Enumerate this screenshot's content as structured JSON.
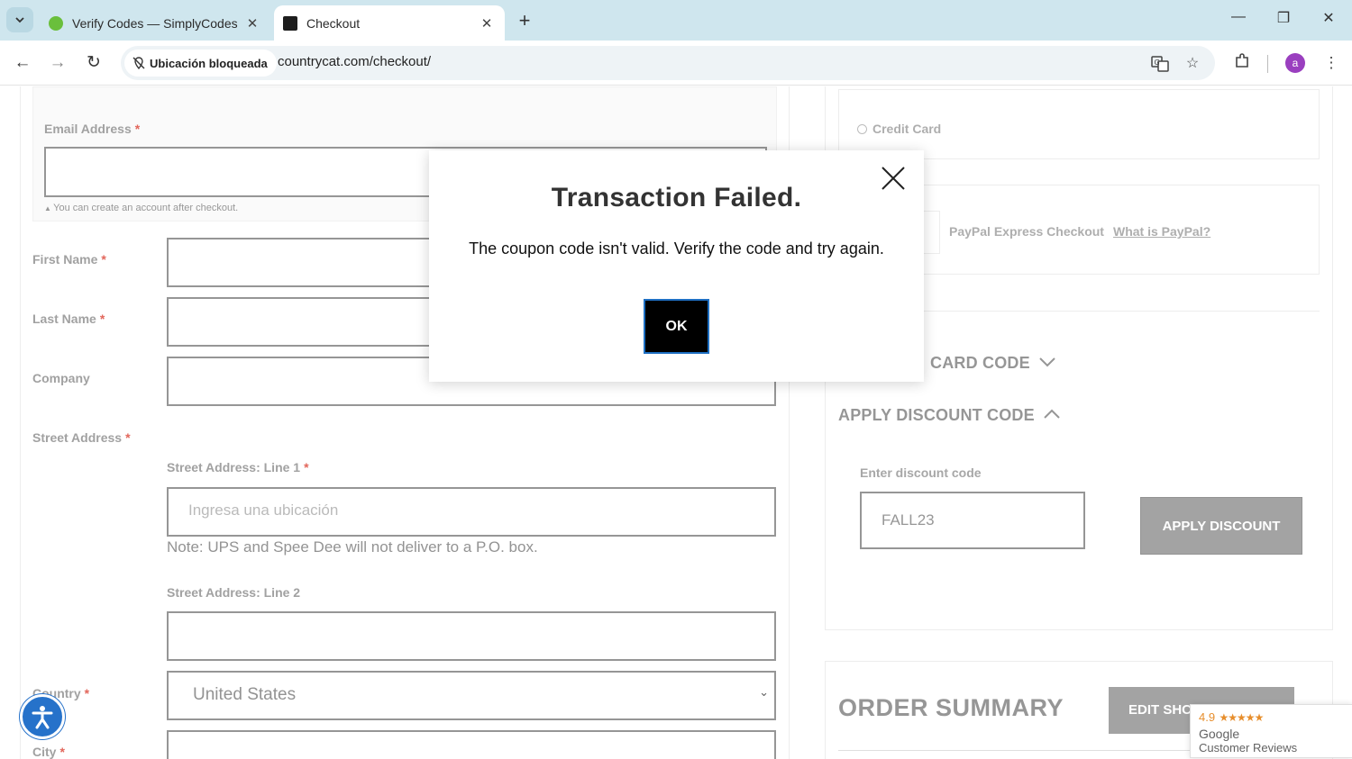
{
  "browser": {
    "tabs": [
      {
        "title": "Verify Codes — SimplyCodes",
        "active": false
      },
      {
        "title": "Checkout",
        "active": true
      }
    ],
    "site_status": "Ubicación bloqueada",
    "url": "countrycat.com/checkout/",
    "profile_initial": "a"
  },
  "form": {
    "email_label": "Email Address",
    "email_hint": "You can create an account after checkout.",
    "first_name_label": "First Name",
    "last_name_label": "Last Name",
    "company_label": "Company",
    "street_label": "Street Address",
    "street_line1_label": "Street Address: Line 1",
    "street_line1_placeholder": "Ingresa una ubicación",
    "street_note": "Note: UPS and Spee Dee will not deliver to a P.O. box.",
    "street_line2_label": "Street Address: Line 2",
    "country_label": "Country",
    "country_value": "United States",
    "city_label": "City",
    "required_mark": "*"
  },
  "payment": {
    "credit_card_label": "Credit Card",
    "paypal_label": "PayPal Express Checkout",
    "paypal_link": "What is PayPal?",
    "gift_card_heading": "CARD CODE",
    "discount_heading": "APPLY DISCOUNT CODE",
    "discount_field_label": "Enter discount code",
    "discount_value": "FALL23",
    "apply_button": "APPLY DISCOUNT"
  },
  "summary": {
    "title": "ORDER SUMMARY",
    "edit_button": "EDIT SHC"
  },
  "reviews_badge": {
    "rating": "4.9",
    "stars": "★★★★★",
    "brand": "Google",
    "subtitle": "Customer Reviews"
  },
  "modal": {
    "title": "Transaction Failed.",
    "message": "The coupon code isn't valid. Verify the code and try again.",
    "ok_button": "OK"
  },
  "colors": {
    "tabbar_bg": "#cfe6ee",
    "modal_ok_bg": "#000000",
    "modal_ok_border": "#1e6fc2",
    "apply_button_bg": "#9c9c9c",
    "accessibility_button": "#1466c6",
    "required_mark": "#e05a4e"
  }
}
